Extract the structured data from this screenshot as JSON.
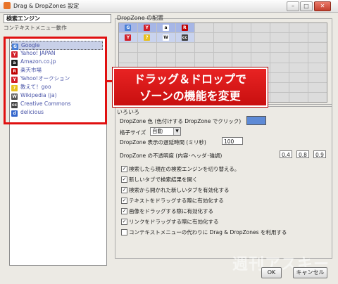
{
  "window": {
    "title": "Drag & DropZones 設定",
    "min": "–",
    "max": "□",
    "close": "✕"
  },
  "left": {
    "header": "検索エンジン",
    "tab": "コンテキストメニュー動作",
    "engines": [
      {
        "label": "Google",
        "icon": "google-icon",
        "color": "#4a7fd6",
        "glyph": "G"
      },
      {
        "label": "Yahoo! JAPAN",
        "icon": "yahoo-icon",
        "color": "#d2202a",
        "glyph": "Y"
      },
      {
        "label": "Amazon.co.jp",
        "icon": "amazon-icon",
        "color": "#222222",
        "glyph": "a"
      },
      {
        "label": "楽天市場",
        "icon": "rakuten-icon",
        "color": "#bf0000",
        "glyph": "R"
      },
      {
        "label": "Yahoo!オークション",
        "icon": "yahoo-auction-icon",
        "color": "#d2202a",
        "glyph": "Y"
      },
      {
        "label": "教えて！goo",
        "icon": "goo-icon",
        "color": "#e8c020",
        "glyph": "?"
      },
      {
        "label": "Wikipedia (ja)",
        "icon": "wikipedia-icon",
        "color": "#555555",
        "glyph": "W"
      },
      {
        "label": "Creative Commons",
        "icon": "creative-commons-icon",
        "color": "#444444",
        "glyph": "cc"
      },
      {
        "label": "delicious",
        "icon": "delicious-icon",
        "color": "#3366cc",
        "glyph": "d"
      }
    ]
  },
  "dropzone": {
    "label": "DropZone の配置"
  },
  "callout": {
    "line1": "ドラッグ＆ドロップで",
    "line2": "ゾーンの機能を変更"
  },
  "misc": {
    "label": "いろいろ",
    "color_label": "DropZone 色 (色付けする DropZone でクリック)",
    "color_value": "#5d8ad6",
    "grid_label": "格子サイズ",
    "grid_value": "自動",
    "delay_label": "DropZone 表示の遅延時間 (ミリ秒)",
    "delay_value": "100",
    "opacity_label": "DropZone の不透明度 (内容･ヘッダ･強調)",
    "opacity_values": [
      "0.4",
      "0.8",
      "0.9"
    ],
    "checks": [
      {
        "label": "検索したら現在の検索エンジンを切り替える。",
        "checked": "✓"
      },
      {
        "label": "新しいタブで検索結果を開く",
        "checked": "✓"
      },
      {
        "label": "検索から開かれた新しいタブを有効化する",
        "checked": "✓"
      },
      {
        "label": "テキストをドラッグする際に有効化する",
        "checked": "✓"
      },
      {
        "label": "画像をドラッグする際に有効化する",
        "checked": "✓"
      },
      {
        "label": "リンクをドラッグする際に有効化する",
        "checked": "✓"
      },
      {
        "label": "コンテキストメニューの代わりに Drag & DropZones を利用する",
        "checked": ""
      }
    ]
  },
  "buttons": {
    "ok": "OK",
    "cancel": "キャンセル"
  },
  "watermark": "週刊アスキー"
}
